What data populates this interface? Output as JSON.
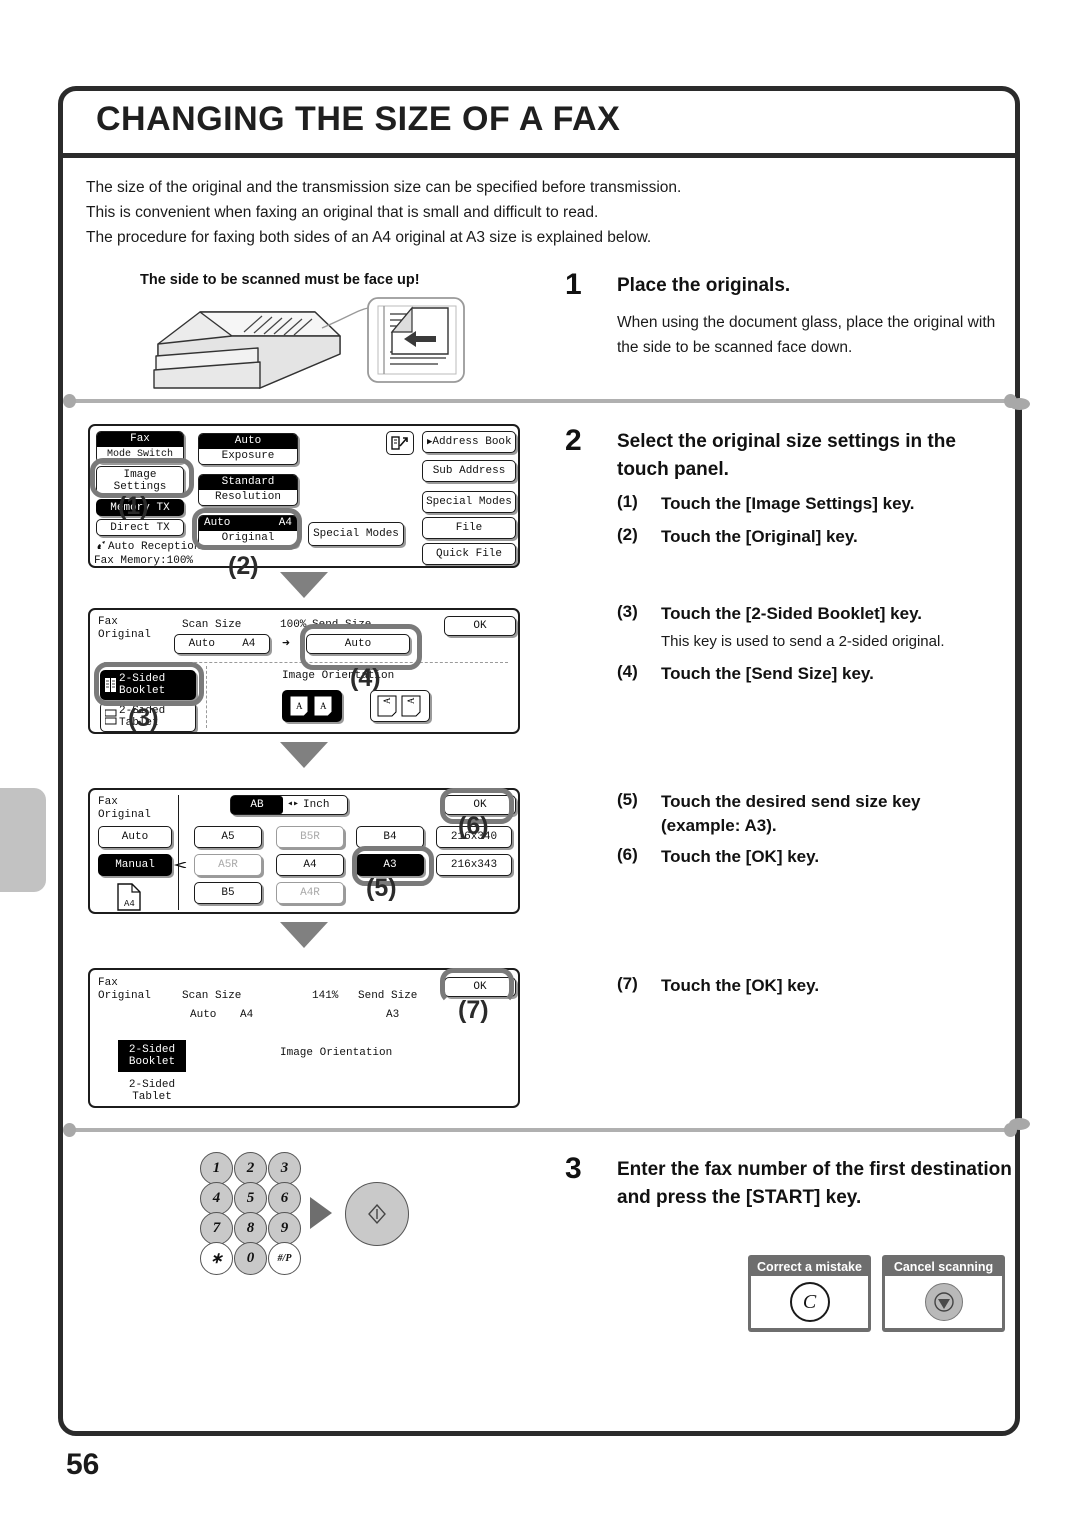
{
  "page": {
    "title": "CHANGING THE SIZE OF A FAX",
    "number": "56"
  },
  "intro": {
    "line1": "The size of the original and the transmission size can be specified before transmission.",
    "line2": "This is convenient when faxing an original that is small and difficult to read.",
    "line3": "The procedure for faxing both sides of an A4 original at A3 size is explained below."
  },
  "illustration": {
    "caption": "The side to be scanned must be face up!"
  },
  "steps": {
    "s1": {
      "num": "1",
      "title": "Place the originals.",
      "body": "When using the document glass, place the original with the side to be scanned face down."
    },
    "s2": {
      "num": "2",
      "title": "Select the original size settings in the touch panel.",
      "sub1_num": "(1)",
      "sub1_text": "Touch the [Image Settings] key.",
      "sub2_num": "(2)",
      "sub2_text": "Touch the [Original] key.",
      "sub3_num": "(3)",
      "sub3_text": "Touch the [2-Sided Booklet] key.",
      "sub3_note": "This key is used to send a 2-sided original.",
      "sub4_num": "(4)",
      "sub4_text": "Touch the [Send Size] key.",
      "sub5_num": "(5)",
      "sub5_text": "Touch the desired send size key (example: A3).",
      "sub6_num": "(6)",
      "sub6_text": "Touch the [OK] key.",
      "sub7_num": "(7)",
      "sub7_text": "Touch the [OK] key."
    },
    "s3": {
      "num": "3",
      "title": "Enter the fax number of the first destination and press the [START] key."
    }
  },
  "panel1": {
    "mode_switch_top": "Fax",
    "mode_switch_bot": "Mode Switch",
    "image_settings_l1": "Image",
    "image_settings_l2": "Settings",
    "memory_tx": "Memory TX",
    "direct_tx": "Direct TX",
    "auto_reception": "Auto Reception",
    "fax_memory": "Fax Memory:100% ",
    "exposure_top": "Auto",
    "exposure_bot": "Exposure",
    "resolution_top": "Standard",
    "resolution_bot": "Resolution",
    "original_top_left": "Auto",
    "original_top_right": "A4",
    "original_bot": "Original",
    "special_modes_mid": "Special Modes",
    "address_book": "Address Book",
    "sub_address": "Sub Address",
    "special_modes": "Special Modes",
    "file": "File",
    "quick_file": "Quick File",
    "callout_1": "(1)",
    "callout_2": "(2)"
  },
  "panel2": {
    "header_l1": "Fax",
    "header_l2": "Original",
    "scan_size_label": "Scan Size",
    "scan_size_left": "Auto",
    "scan_size_right": "A4",
    "ratio": "100%",
    "arrow": "➜",
    "send_size_label": "Send Size",
    "send_size_value": "Auto",
    "ok": "OK",
    "two_sided_booklet_l1": "2-Sided",
    "two_sided_booklet_l2": "Booklet",
    "two_sided_tablet_l1": "2-Sided",
    "two_sided_tablet_l2": "Tablet",
    "image_orientation": "Image Orientation",
    "callout_3": "(3)",
    "callout_4": "(4)"
  },
  "panel3": {
    "header_l1": "Fax",
    "header_l2": "Original",
    "ab_tab": "AB",
    "inch_tab": "Inch",
    "ok": "OK",
    "auto": "Auto",
    "manual": "Manual",
    "paper_icon_label": "A4",
    "sizes": [
      {
        "label": "A5",
        "state": "normal"
      },
      {
        "label": "B5R",
        "state": "dim"
      },
      {
        "label": "B4",
        "state": "normal"
      },
      {
        "label": "216x340",
        "state": "normal"
      },
      {
        "label": "A5R",
        "state": "dim"
      },
      {
        "label": "A4",
        "state": "normal"
      },
      {
        "label": "A3",
        "state": "selected"
      },
      {
        "label": "216x343",
        "state": "normal"
      },
      {
        "label": "B5",
        "state": "normal"
      },
      {
        "label": "A4R",
        "state": "dim"
      }
    ],
    "callout_5": "(5)",
    "callout_6": "(6)"
  },
  "panel4": {
    "header_l1": "Fax",
    "header_l2": "Original",
    "scan_size_label": "Scan Size",
    "scan_size_left": "Auto",
    "scan_size_right": "A4",
    "ratio": "141%",
    "send_size_label": "Send Size",
    "send_size_value": "A3",
    "ok": "OK",
    "two_sided_booklet_l1": "2-Sided",
    "two_sided_booklet_l2": "Booklet",
    "two_sided_tablet_l1": "2-Sided",
    "two_sided_tablet_l2": "Tablet",
    "image_orientation": "Image Orientation",
    "callout_7": "(7)"
  },
  "keypad": {
    "keys": [
      "1",
      "2",
      "3",
      "4",
      "5",
      "6",
      "7",
      "8",
      "9",
      "∗",
      "0",
      "#/P"
    ]
  },
  "bottom_boxes": {
    "correct_title": "Correct a mistake",
    "correct_glyph": "C",
    "cancel_title": "Cancel scanning"
  }
}
